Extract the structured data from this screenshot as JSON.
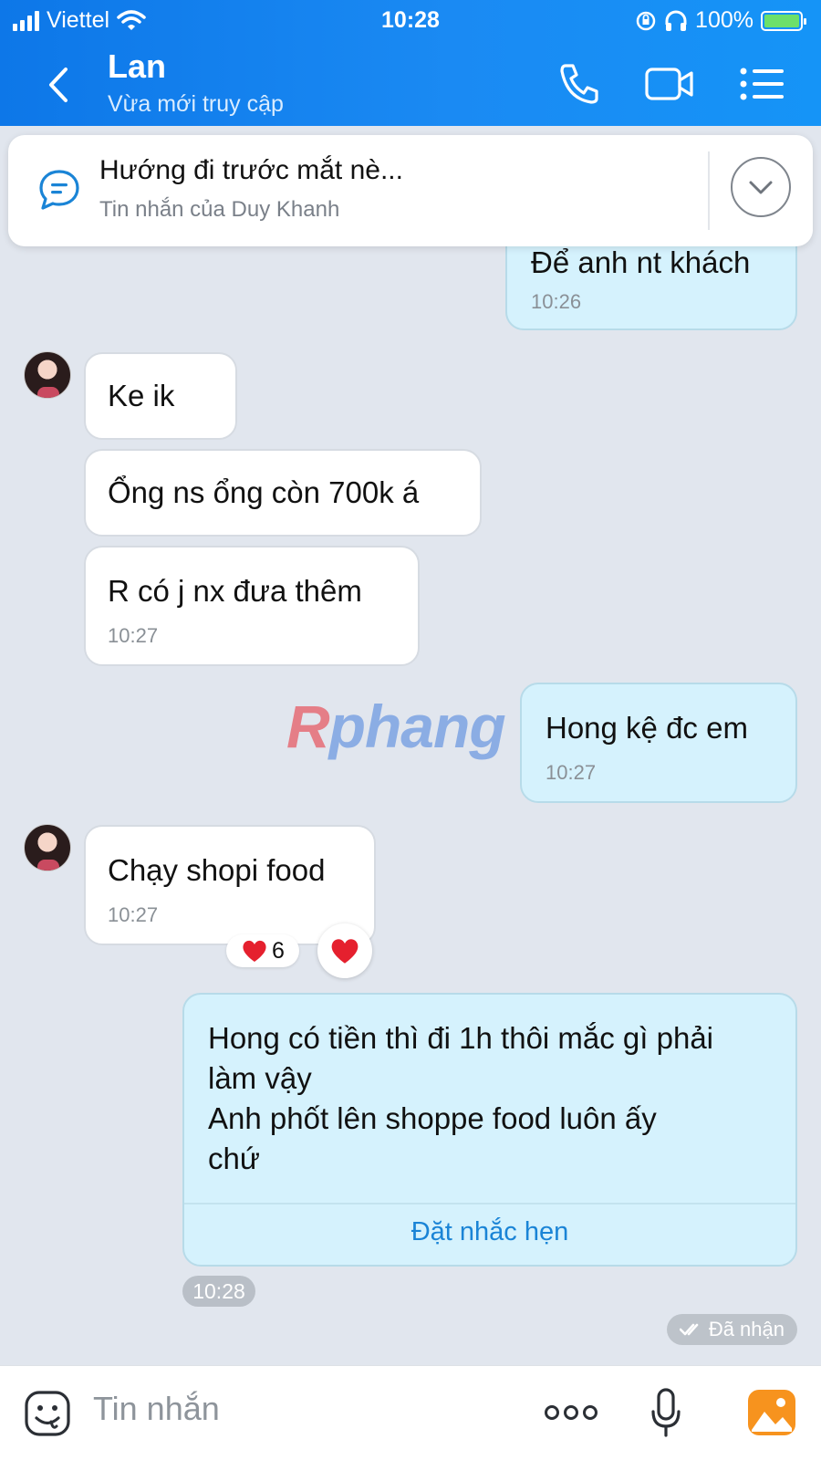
{
  "status_bar": {
    "carrier": "Viettel",
    "time": "10:28",
    "battery": "100%"
  },
  "header": {
    "contact_name": "Lan",
    "contact_status": "Vừa mới truy cập"
  },
  "pinned": {
    "title": "Hướng đi trước mắt nè...",
    "subtitle": "Tin nhắn của Duy Khanh"
  },
  "messages": [
    {
      "side": "out",
      "text": "Để anh nt khách",
      "time": "10:26"
    },
    {
      "side": "in",
      "text": "Ke ik"
    },
    {
      "side": "in",
      "text": "Ổng ns ổng còn 700k á"
    },
    {
      "side": "in",
      "text": "R có j nx đưa thêm",
      "time": "10:27"
    },
    {
      "side": "out",
      "text": "Hong kệ đc em",
      "time": "10:27"
    },
    {
      "side": "in",
      "text": "Chạy shopi food",
      "time": "10:27",
      "reaction_count": "6"
    },
    {
      "side": "out",
      "text": "Hong có tiền thì đi 1h thôi mắc gì phải\nlàm vậy\nAnh phốt lên shoppe food luôn ấy\nchứ",
      "action": "Đặt nhắc hẹn",
      "time": "10:28"
    }
  ],
  "read_receipt": "Đã nhận",
  "watermark": {
    "first": "R",
    "rest": "phang"
  },
  "input": {
    "placeholder": "Tin nhắn"
  },
  "colors": {
    "header": "#1a8af3",
    "bubble_out": "#d5f2fd",
    "bubble_in": "#ffffff",
    "link": "#1a84d6"
  }
}
